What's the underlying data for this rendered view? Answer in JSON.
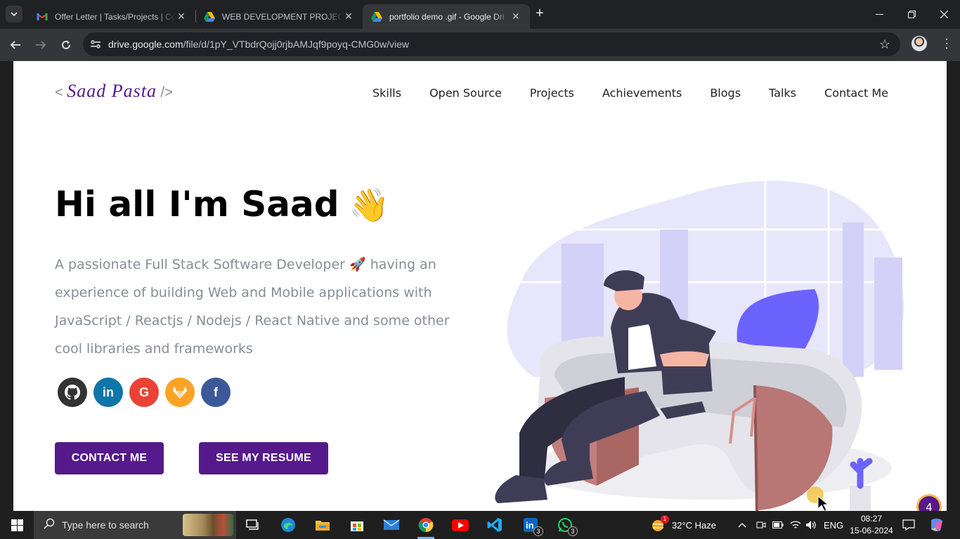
{
  "browser": {
    "tabs": [
      {
        "title": "Offer Letter | Tasks/Projects | Co",
        "favicon": "gmail-icon",
        "active": false
      },
      {
        "title": "WEB DEVELOPMENT PROJECTS",
        "favicon": "google-drive-icon",
        "active": false
      },
      {
        "title": "portfolio demo .gif - Google Dri",
        "favicon": "google-drive-icon",
        "active": true
      }
    ],
    "url_host": "drive.google.com",
    "url_path": "/file/d/1pY_VTbdrQojj0rjbAMJqf9poyq-CMG0w/view"
  },
  "site": {
    "logo_open": "< ",
    "logo_name": "Saad Pasta",
    "logo_close": " />",
    "menu": [
      "Skills",
      "Open Source",
      "Projects",
      "Achievements",
      "Blogs",
      "Talks",
      "Contact Me"
    ],
    "greeting": "Hi all I'm Saad",
    "greeting_emoji": "👋",
    "bio_1": "A passionate Full Stack Software Developer ",
    "bio_emoji": "🚀",
    "bio_2": " having an experience of building Web and Mobile applications with JavaScript / Reactjs / Nodejs / React Native and some other cool libraries and frameworks",
    "socials": [
      {
        "name": "github",
        "glyph": "",
        "color": "#333333"
      },
      {
        "name": "linkedin",
        "glyph": "in",
        "color": "#0e76a8"
      },
      {
        "name": "google",
        "glyph": "G",
        "color": "#ea4335"
      },
      {
        "name": "gitlab",
        "glyph": "",
        "color": "#fca326"
      },
      {
        "name": "facebook",
        "glyph": "f",
        "color": "#3b5998"
      }
    ],
    "contact_button": "CONTACT ME",
    "resume_button": "SEE MY RESUME",
    "badge_count": "4",
    "accent_color": "#55198b"
  },
  "taskbar": {
    "search_placeholder": "Type here to search",
    "linkedin_count": "3",
    "whatsapp_count": "3",
    "weather_alert": "1",
    "weather": "32°C  Haze",
    "language": "ENG",
    "time": "08:27",
    "date": "15-06-2024"
  }
}
